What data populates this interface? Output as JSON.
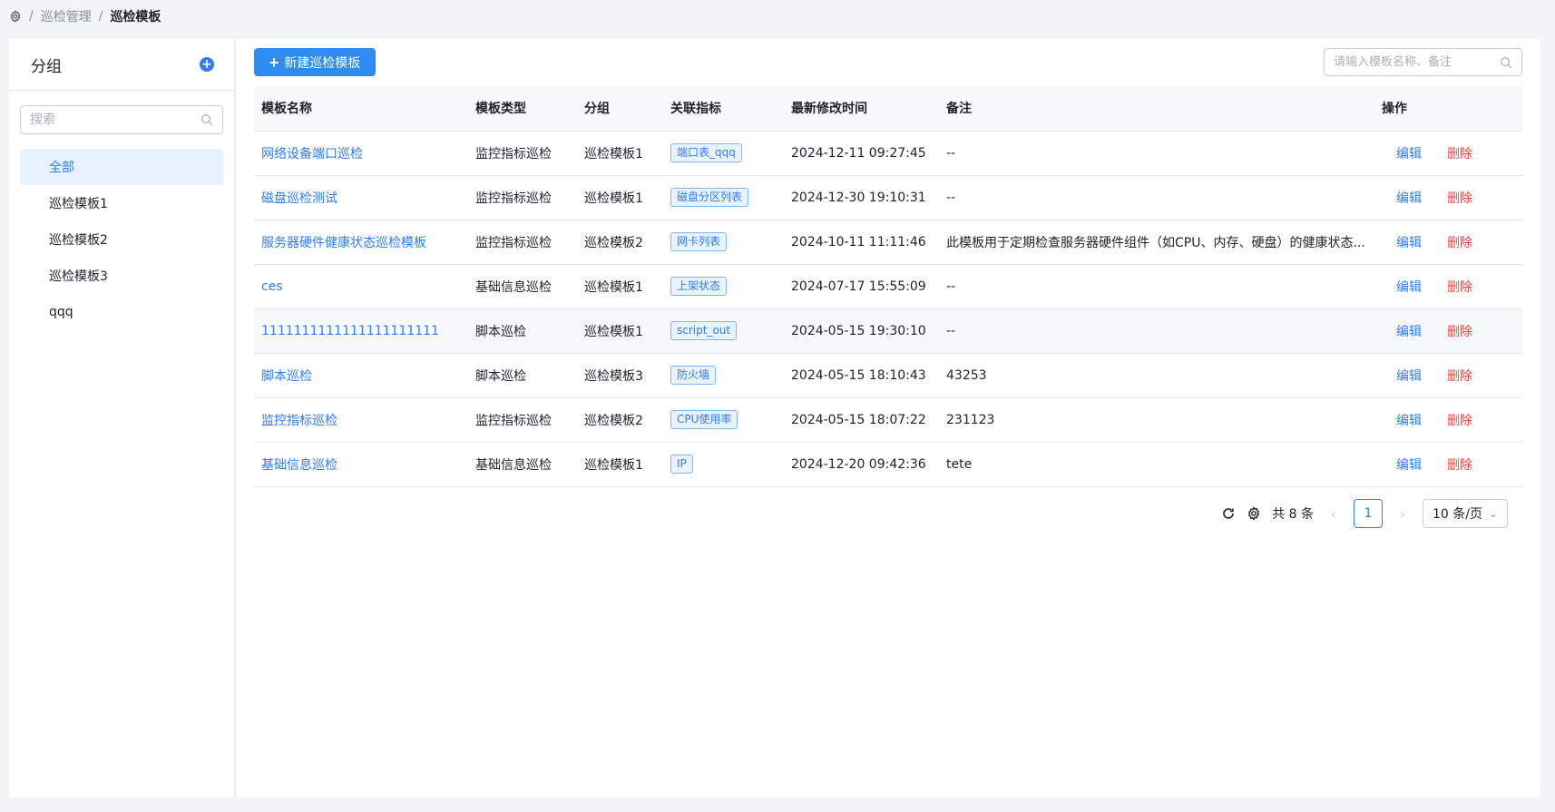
{
  "breadcrumb": {
    "icon": "settings-gear-icon",
    "items": [
      "巡检管理",
      "巡检模板"
    ],
    "separator": "/"
  },
  "sidebar": {
    "title": "分组",
    "add_icon": "plus-circle-icon",
    "search_placeholder": "搜索",
    "items": [
      {
        "label": "全部",
        "active": true
      },
      {
        "label": "巡检模板1",
        "active": false
      },
      {
        "label": "巡检模板2",
        "active": false
      },
      {
        "label": "巡检模板3",
        "active": false
      },
      {
        "label": "qqq",
        "active": false
      }
    ]
  },
  "toolbar": {
    "new_button_label": "新建巡检模板",
    "search_placeholder": "请输入模板名称、备注"
  },
  "table": {
    "columns": [
      "模板名称",
      "模板类型",
      "分组",
      "关联指标",
      "最新修改时间",
      "备注",
      "操作"
    ],
    "edit_label": "编辑",
    "delete_label": "删除",
    "rows": [
      {
        "name": "网络设备端口巡检",
        "type": "监控指标巡检",
        "group": "巡检模板1",
        "metric": "端口表_qqq",
        "time": "2024-12-11 09:27:45",
        "remark": "--"
      },
      {
        "name": "磁盘巡检测试",
        "type": "监控指标巡检",
        "group": "巡检模板1",
        "metric": "磁盘分区列表",
        "time": "2024-12-30 19:10:31",
        "remark": "--"
      },
      {
        "name": "服务器硬件健康状态巡检模板",
        "type": "监控指标巡检",
        "group": "巡检模板2",
        "metric": "网卡列表",
        "time": "2024-10-11 11:11:46",
        "remark": "此模板用于定期检查服务器硬件组件（如CPU、内存、硬盘）的健康状态..."
      },
      {
        "name": "ces",
        "type": "基础信息巡检",
        "group": "巡检模板1",
        "metric": "上架状态",
        "time": "2024-07-17 15:55:09",
        "remark": "--"
      },
      {
        "name": "1111111111111111111111",
        "type": "脚本巡检",
        "group": "巡检模板1",
        "metric": "script_out",
        "time": "2024-05-15 19:30:10",
        "remark": "--"
      },
      {
        "name": "脚本巡检",
        "type": "脚本巡检",
        "group": "巡检模板3",
        "metric": "防火墙",
        "time": "2024-05-15 18:10:43",
        "remark": "43253"
      },
      {
        "name": "监控指标巡检",
        "type": "监控指标巡检",
        "group": "巡检模板2",
        "metric": "CPU使用率",
        "time": "2024-05-15 18:07:22",
        "remark": "231123"
      },
      {
        "name": "基础信息巡检",
        "type": "基础信息巡检",
        "group": "巡检模板1",
        "metric": "IP",
        "time": "2024-12-20 09:42:36",
        "remark": "tete"
      }
    ]
  },
  "pagination": {
    "refresh_icon": "refresh-icon",
    "settings_icon": "settings-icon",
    "total_text": "共 8 条",
    "current_page": "1",
    "page_size": "10 条/页"
  },
  "colors": {
    "accent": "#2e7cf6",
    "danger": "#f53f3f"
  }
}
